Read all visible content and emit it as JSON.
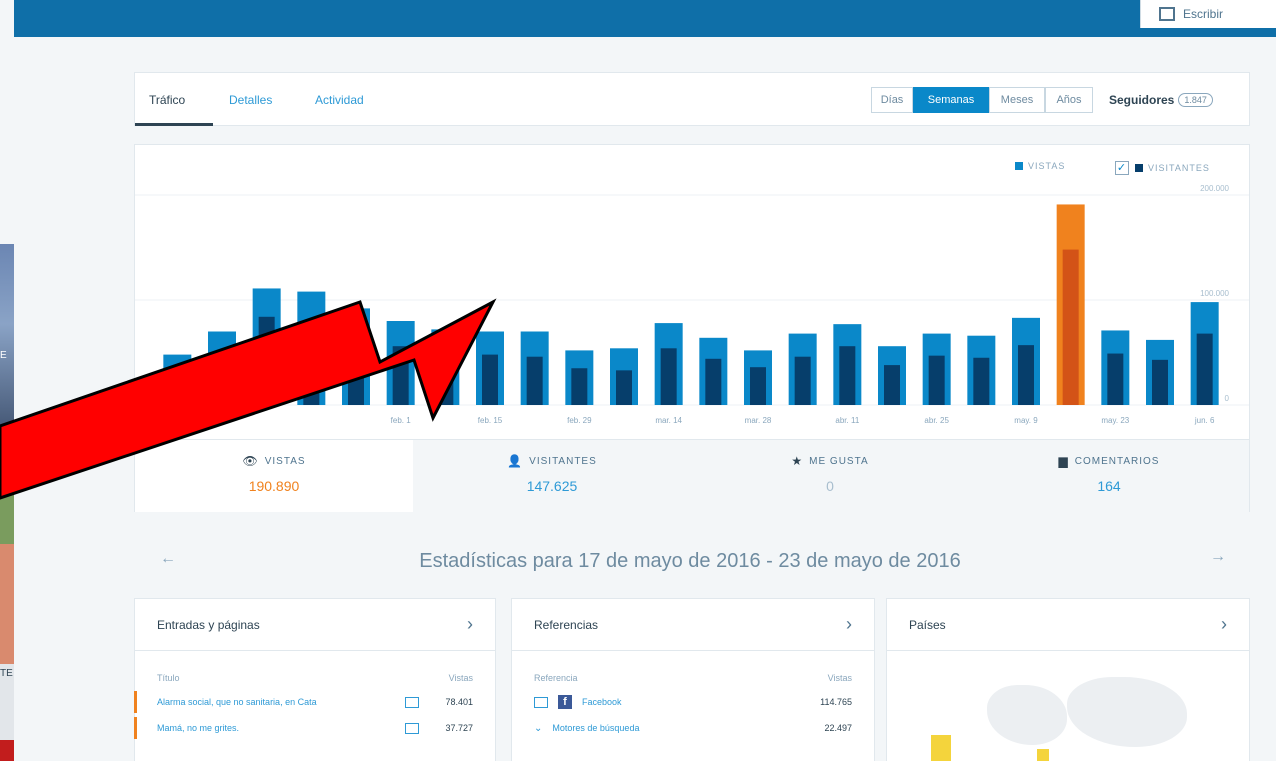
{
  "header": {
    "write_label": "Escribir"
  },
  "left_strip": {
    "text_a": "E",
    "text_b": "TE"
  },
  "tabs": [
    {
      "label": "Tráfico",
      "active": true
    },
    {
      "label": "Detalles",
      "active": false
    },
    {
      "label": "Actividad",
      "active": false
    }
  ],
  "periods": [
    {
      "label": "Días",
      "selected": false
    },
    {
      "label": "Semanas",
      "selected": true
    },
    {
      "label": "Meses",
      "selected": false
    },
    {
      "label": "Años",
      "selected": false
    }
  ],
  "followers": {
    "label": "Seguidores",
    "count": "1.847"
  },
  "legend": {
    "views": "VISTAS",
    "visitors": "VISITANTES"
  },
  "chart_data": {
    "type": "bar",
    "categories": [
      "",
      "",
      "",
      "",
      "",
      "feb. 1",
      "",
      "feb. 15",
      "",
      "feb. 29",
      "",
      "mar. 14",
      "",
      "mar. 28",
      "",
      "abr. 11",
      "",
      "abr. 25",
      "",
      "may. 9",
      "",
      "may. 23",
      "",
      "jun. 6"
    ],
    "series": [
      {
        "name": "VISTAS",
        "values": [
          48000,
          70000,
          111000,
          108000,
          92000,
          80000,
          72000,
          70000,
          70000,
          52000,
          54000,
          78000,
          64000,
          52000,
          68000,
          77000,
          56000,
          68000,
          66000,
          83000,
          191000,
          71000,
          62000,
          98000
        ]
      },
      {
        "name": "VISITANTES",
        "values": [
          28000,
          46000,
          84000,
          75000,
          66000,
          56000,
          50000,
          48000,
          46000,
          35000,
          33000,
          54000,
          44000,
          36000,
          46000,
          56000,
          38000,
          47000,
          45000,
          57000,
          148000,
          49000,
          43000,
          68000
        ]
      }
    ],
    "highlight_index": 20,
    "ylim": [
      0,
      200000
    ],
    "yticks": [
      "0",
      "100.000",
      "200.000"
    ],
    "colors": {
      "views": "#0a88c9",
      "visitors": "#063e6b",
      "highlight_views": "#f0821e",
      "highlight_visitors": "#d35317"
    }
  },
  "stats": [
    {
      "label": "VISTAS",
      "value": "190.890",
      "glyph": "eye-icon"
    },
    {
      "label": "VISITANTES",
      "value": "147.625",
      "glyph": "user-icon"
    },
    {
      "label": "ME GUSTA",
      "value": "0",
      "glyph": "star-icon"
    },
    {
      "label": "COMENTARIOS",
      "value": "164",
      "glyph": "comment-icon"
    }
  ],
  "period_title": "Estadísticas para 17 de mayo de 2016 - 23 de mayo de 2016",
  "posts": {
    "title": "Entradas y páginas",
    "col_title": "Título",
    "col_views": "Vistas",
    "rows": [
      {
        "name": "Alarma social, que no sanitaria, en Cata",
        "views": "78.401"
      },
      {
        "name": "Mamá, no me grites.",
        "views": "37.727"
      }
    ]
  },
  "referrers": {
    "title": "Referencias",
    "col_ref": "Referencia",
    "col_views": "Vistas",
    "rows": [
      {
        "name": "Facebook",
        "views": "114.765"
      },
      {
        "name": "Motores de búsqueda",
        "views": "22.497"
      }
    ]
  },
  "countries": {
    "title": "Países"
  }
}
